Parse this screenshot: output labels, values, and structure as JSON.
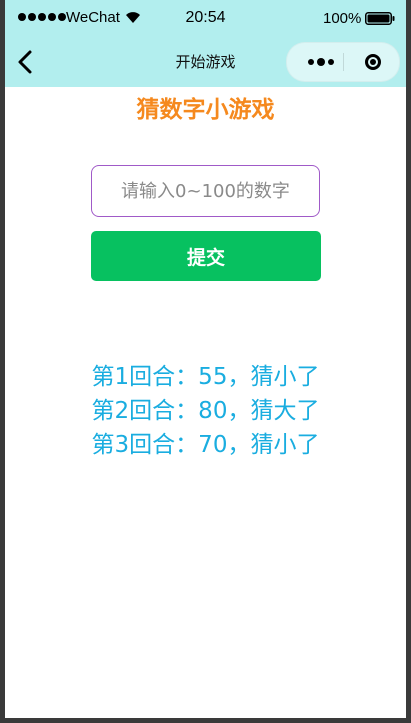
{
  "status_bar": {
    "carrier": "WeChat",
    "time": "20:54",
    "battery_percent": "100%",
    "battery_level": 1.0,
    "signal_bars": 5
  },
  "nav": {
    "title": "开始游戏"
  },
  "game": {
    "title": "猜数字小游戏",
    "input_placeholder": "请输入0~100的数字",
    "input_value": "",
    "submit_label": "提交",
    "rounds": [
      "第1回合：55，猜小了",
      "第2回合：80，猜大了",
      "第3回合：70，猜小了"
    ]
  },
  "colors": {
    "nav_background": "#b2eeee",
    "title_color": "#f5891e",
    "button_color": "#07c160",
    "result_color": "#1aade0",
    "input_border": "#a05ac8"
  }
}
